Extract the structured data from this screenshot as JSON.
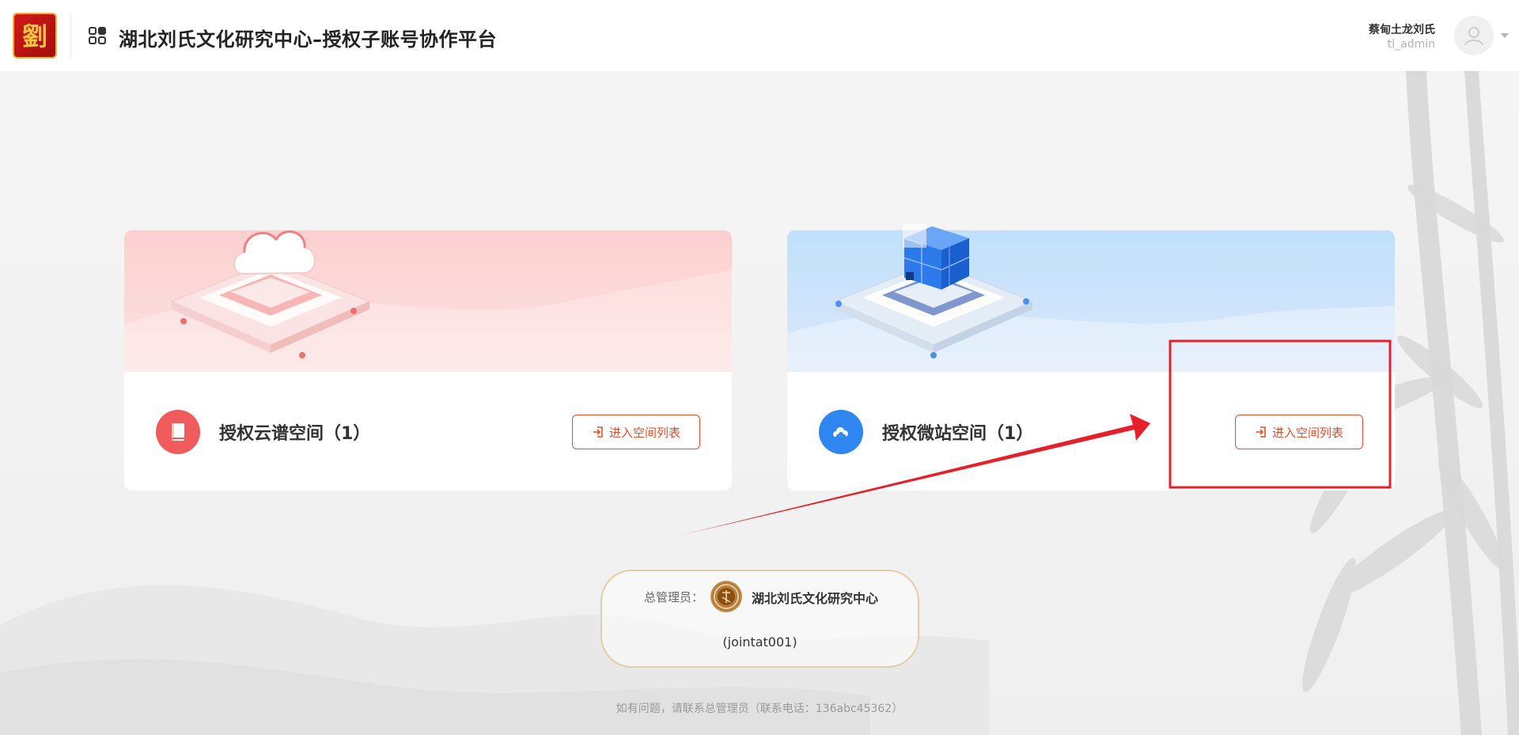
{
  "header": {
    "title": "湖北刘氏文化研究中心–授权子账号协作平台",
    "logo_char": "劉",
    "apps_icon": "apps-grid-icon",
    "user_name": "蔡甸土龙刘氏",
    "user_account": "tl_admin"
  },
  "cards": [
    {
      "title": "授权云谱空间（1）",
      "icon": "book-icon",
      "button_label": "进入空间列表",
      "accent": "#f05b5b"
    },
    {
      "title": "授权微站空间（1）",
      "icon": "cloud-icon",
      "button_label": "进入空间列表",
      "accent": "#2f86f0"
    }
  ],
  "admin": {
    "label": "总管理员：",
    "name": "湖北刘氏文化研究中心",
    "account": "(jointat001)"
  },
  "footer": {
    "note": "如有问题，请联系总管理员（联系电话：136abc45362）"
  },
  "colors": {
    "button_accent": "#ee4a24",
    "annotation_red": "#e5202a",
    "admin_border": "#e3cda4"
  }
}
